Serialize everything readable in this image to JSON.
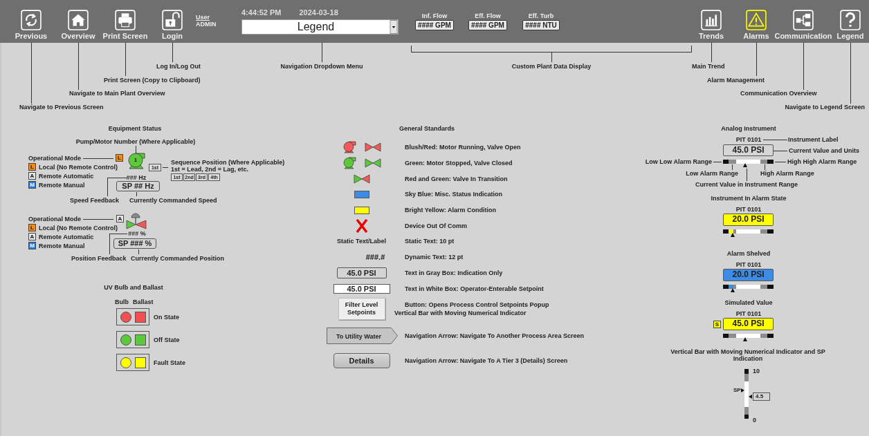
{
  "header": {
    "left_buttons": [
      {
        "label": "Previous",
        "kind": "refresh",
        "alarm": false
      },
      {
        "label": "Overview",
        "kind": "home",
        "alarm": false
      },
      {
        "label": "Print Screen",
        "kind": "printer",
        "alarm": false
      },
      {
        "label": "Login",
        "kind": "lock",
        "alarm": false
      }
    ],
    "user": {
      "label": "User",
      "name": "ADMIN"
    },
    "time": "4:44:52 PM",
    "date": "2024-03-18",
    "nav_dropdown": {
      "value": "Legend"
    },
    "plant_data": [
      {
        "label": "Inf. Flow",
        "value": "#### GPM"
      },
      {
        "label": "Eff. Flow",
        "value": "#### GPM"
      },
      {
        "label": "Eff. Turb",
        "value": "#### NTU"
      }
    ],
    "right_buttons": [
      {
        "label": "Trends",
        "kind": "chart",
        "alarm": false
      },
      {
        "label": "Alarms",
        "kind": "warning",
        "alarm": true
      },
      {
        "label": "Communication",
        "kind": "network",
        "alarm": false
      },
      {
        "label": "Legend",
        "kind": "help",
        "alarm": false
      }
    ]
  },
  "header_callouts": [
    "Log In/Log Out",
    "Navigation Dropdown Menu",
    "Print Screen (Copy to Clipboard)",
    "Navigate to Main Plant Overview",
    "Navigate to Previous Screen",
    "Custom Plant Data Display",
    "Main Trend",
    "Alarm Management",
    "Communication Overview",
    "Navigate to Legend Screen"
  ],
  "equipment_status": {
    "title": "Equipment Status",
    "pump": {
      "number_label": "Pump/Motor Number (Where Applicable)",
      "number": "1",
      "mode_label": "Operational Mode",
      "mode": {
        "badge": "L",
        "kind": "local"
      },
      "modes": [
        {
          "badge": "L",
          "label": "Local (No Remote Control)",
          "kind": "local"
        },
        {
          "badge": "A",
          "label": "Remote Automatic",
          "kind": "auto"
        },
        {
          "badge": "M",
          "label": "Remote Manual",
          "kind": "manual"
        }
      ],
      "sequence": {
        "badge": "1st",
        "title": "Sequence Position (Where Applicable)",
        "note": "1st = Lead, 2nd = Lag, etc.",
        "positions": [
          "1st",
          "2nd",
          "3rd",
          "4th"
        ]
      },
      "feedback": "### Hz",
      "setpoint": "SP ## Hz",
      "feedback_label": "Speed Feedback",
      "setpoint_label": "Currently Commanded Speed"
    },
    "valve": {
      "mode_label": "Operational Mode",
      "mode": {
        "badge": "A",
        "kind": "auto"
      },
      "modes": [
        {
          "badge": "L",
          "label": "Local (No Remote Control)",
          "kind": "local"
        },
        {
          "badge": "A",
          "label": "Remote Automatic",
          "kind": "auto"
        },
        {
          "badge": "M",
          "label": "Remote Manual",
          "kind": "manual"
        }
      ],
      "feedback": "### %",
      "setpoint": "SP ### %",
      "feedback_label": "Position Feedback",
      "setpoint_label": "Currently Commanded Position"
    },
    "uv": {
      "title": "UV Bulb and Ballast",
      "headers": [
        "Bulb",
        "Ballast"
      ],
      "states": [
        {
          "label": "On State",
          "color": "#f05050"
        },
        {
          "label": "Off State",
          "color": "#5cc83c"
        },
        {
          "label": "Fault State",
          "color": "#ffff00"
        }
      ]
    }
  },
  "general_standards": {
    "title": "General Standards",
    "rows": [
      {
        "kind": "pump_valve",
        "color": "#f05a5a",
        "text": "Blush/Red: Motor Running, Valve Open"
      },
      {
        "kind": "pump_valve",
        "color": "#5cc83c",
        "text": "Green: Motor Stopped, Valve Closed"
      },
      {
        "kind": "transition",
        "text": "Red and Green: Valve In Transition"
      },
      {
        "kind": "swatch",
        "color": "#3c8ce6",
        "text": "Sky Blue: Misc. Status Indication"
      },
      {
        "kind": "swatch",
        "color": "#ffff00",
        "text": "Bright Yellow: Alarm Condition"
      },
      {
        "kind": "cross",
        "text": "Device Out Of Comm"
      },
      {
        "kind": "static",
        "sample": "Static Text/Label",
        "text": "Static Text: 10 pt"
      },
      {
        "kind": "dynamic",
        "sample": "###.#",
        "text": "Dynamic Text: 12 pt"
      },
      {
        "kind": "graybox",
        "sample": "45.0 PSI",
        "text": "Text in Gray Box: Indication Only"
      },
      {
        "kind": "whitebox",
        "sample": "45.0 PSI",
        "text": "Text in White Box: Operator-Enterable Setpoint"
      },
      {
        "kind": "button",
        "sample": "Filter Level Setpoints",
        "text": "Button: Opens Process Control Setpoints Popup",
        "text2": "Vertical Bar with Moving Numerical Indicator"
      },
      {
        "kind": "arrow",
        "sample": "To Utility Water",
        "text": "Navigation Arrow: Navigate To Another Process Area Screen"
      },
      {
        "kind": "details",
        "sample": "Details",
        "text": "Navigation Arrow: Navigate To A Tier 3 (Details) Screen"
      }
    ]
  },
  "analog_instrument": {
    "title": "Analog Instrument",
    "tag": "PIT 0101",
    "value": "45.0 PSI",
    "level": 0.45,
    "labels": {
      "instrument": "Instrument Label",
      "value": "Current Value and Units",
      "low_low": "Low Low Alarm Range",
      "high_high": "High High Alarm Range",
      "low": "Low Alarm Range",
      "high": "High Alarm Range",
      "current": "Current Value in Instrument Range"
    },
    "states": [
      {
        "title": "Instrument In Alarm State",
        "tag": "PIT 0101",
        "value": "20.0 PSI",
        "kind": "alarm",
        "level": 0.2
      },
      {
        "title": "Alarm Shelved",
        "tag": "PIT 0101",
        "value": "20.0 PSI",
        "kind": "shelved",
        "level": 0.2
      },
      {
        "title": "Simulated Value",
        "tag": "PIT 0101",
        "value": "45.0 PSI",
        "kind": "simulated",
        "badge": "S",
        "level": 0.45
      }
    ]
  },
  "vertical_bar": {
    "title": "Vertical Bar with Moving Numerical Indicator and SP Indication",
    "max": "10",
    "min": "0",
    "setpoint": {
      "label": "SP",
      "level": 0.57
    },
    "indicator": {
      "value": "4.5",
      "level": 0.45
    }
  }
}
